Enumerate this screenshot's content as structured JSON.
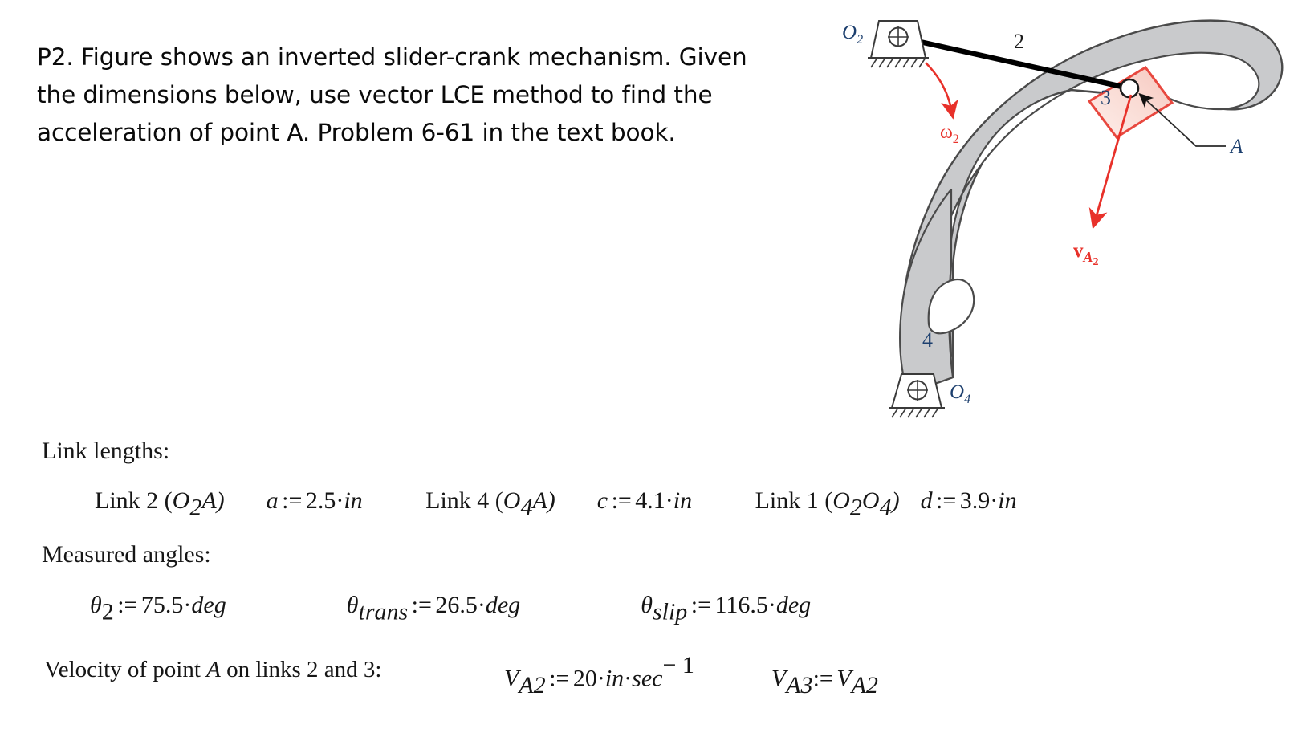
{
  "problem": {
    "line1": "P2. Figure shows an inverted slider-crank mechanism. Given",
    "line2": "the dimensions below, use vector LCE method to find the",
    "line3": "acceleration of point A. Problem 6-61 in the text book."
  },
  "figure": {
    "caption_labels": {
      "o2": "O",
      "o2_sub": "2",
      "o4": "O",
      "o4_sub": "4",
      "link2": "2",
      "link3": "3",
      "link4": "4",
      "point_a": "A",
      "omega2": "ω",
      "omega2_sub": "2",
      "vA2": "v",
      "vA2_sub": "A",
      "vA2_sub2": "2"
    },
    "colors": {
      "link_fill": "#c9cacc",
      "link_stroke": "#4a4a4a",
      "slider_fill": "#f9d9d3",
      "slider_stroke": "#e8483f",
      "vector_red": "#e8312a",
      "label_blue": "#1c3f6e",
      "crank_black": "#000000"
    }
  },
  "given": {
    "link_lengths_heading": "Link lengths:",
    "measured_angles_heading": "Measured angles:",
    "velocity_heading_pre": "Velocity of point ",
    "velocity_heading_var": "A",
    "velocity_heading_post": " on links 2 and 3:",
    "links": [
      {
        "name_pre": "Link 2 (",
        "name_sym": "O",
        "name_sub": "2",
        "name_post": "A)",
        "var": "a",
        "assign": ":=",
        "value": "2.5",
        "unit": "in"
      },
      {
        "name_pre": "Link 4 (",
        "name_sym": "O",
        "name_sub": "4",
        "name_post": "A)",
        "var": "c",
        "assign": ":=",
        "value": "4.1",
        "unit": "in"
      },
      {
        "name_pre": "Link 1 (",
        "name_sym": "O",
        "name_sub": "2",
        "name_sym2": "O",
        "name_sub2": "4",
        "name_post": ")",
        "var": "d",
        "assign": ":=",
        "value": "3.9",
        "unit": "in"
      }
    ],
    "angles": [
      {
        "sym": "θ",
        "sub": "2",
        "assign": ":=",
        "value": "75.5",
        "unit": "deg"
      },
      {
        "sym": "θ",
        "sub": "trans",
        "assign": ":=",
        "value": "26.5",
        "unit": "deg"
      },
      {
        "sym": "θ",
        "sub": "slip",
        "assign": ":=",
        "value": "116.5",
        "unit": "deg"
      }
    ],
    "velocities": [
      {
        "sym": "V",
        "sub": "A2",
        "assign": ":=",
        "value": "20",
        "unit1": "in",
        "unit2": "sec",
        "exponent": "− 1"
      },
      {
        "sym": "V",
        "sub": "A3",
        "assign": ":=",
        "rhs_sym": "V",
        "rhs_sub": "A2"
      }
    ]
  }
}
